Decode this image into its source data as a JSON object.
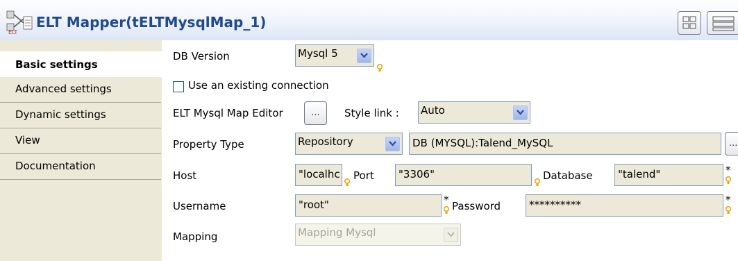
{
  "header": {
    "title": "ELT Mapper(tELTMysqlMap_1)",
    "icon": "elt-map-icon",
    "buttons": [
      "view-compact-icon",
      "view-expand-icon"
    ]
  },
  "sidebar": {
    "tabs": [
      {
        "label": "Basic settings",
        "active": true
      },
      {
        "label": "Advanced settings",
        "active": false
      },
      {
        "label": "Dynamic settings",
        "active": false
      },
      {
        "label": "View",
        "active": false
      },
      {
        "label": "Documentation",
        "active": false
      }
    ]
  },
  "form": {
    "db_version": {
      "label": "DB Version",
      "value": "Mysql 5"
    },
    "use_existing_connection": {
      "label": "Use an existing connection",
      "checked": false
    },
    "map_editor": {
      "label": "ELT Mysql Map Editor",
      "button": "..."
    },
    "style_link": {
      "label": "Style link :",
      "value": "Auto"
    },
    "property_type": {
      "label": "Property Type",
      "value": "Repository",
      "repository_value": "DB (MYSQL):Talend_MySQL",
      "button": "..."
    },
    "host": {
      "label": "Host",
      "value": "\"localhc"
    },
    "port": {
      "label": "Port",
      "value": "\"3306\""
    },
    "database": {
      "label": "Database",
      "value": "\"talend\""
    },
    "username": {
      "label": "Username",
      "value": "\"root\""
    },
    "password": {
      "label": "Password",
      "value": "**********"
    },
    "mapping": {
      "label": "Mapping",
      "value": "Mapping Mysql",
      "disabled": true
    },
    "required_mark": "*"
  },
  "colors": {
    "title": "#1f4a8f",
    "sidebar_bg": "#ece9d8",
    "field_bg": "#ece9d8",
    "field_border": "#7f9db9",
    "bulb": "#f0a000"
  }
}
